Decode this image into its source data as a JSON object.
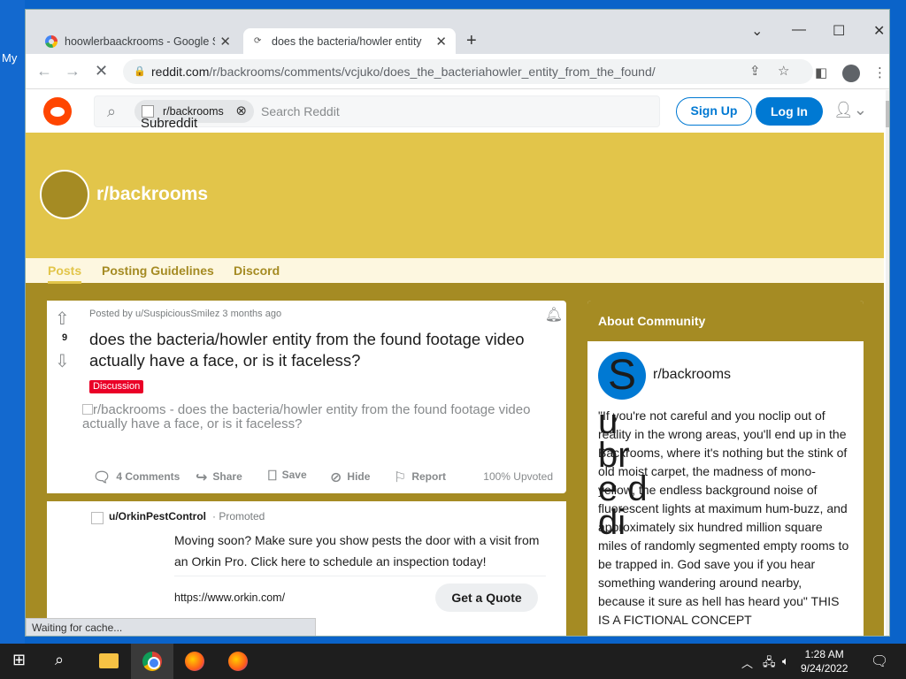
{
  "desktop": {
    "label": "My"
  },
  "browser": {
    "tabs": [
      {
        "title": "hoowlerbaackrooms - Google Se",
        "close": "✕"
      },
      {
        "title": "does the bacteria/howler entity fr",
        "close": "✕"
      }
    ],
    "new_tab": "+",
    "window_controls": {
      "minimize": "—",
      "maximize": "☐",
      "close": "✕",
      "dropdown": "⌄"
    },
    "url_host": "reddit.com",
    "url_path": "/r/backrooms/comments/vcjuko/does_the_bacteriahowler_entity_from_the_found/",
    "status": "Waiting for cache..."
  },
  "reddit": {
    "search": {
      "chip_label": "r/backrooms",
      "chip_alt": "Subreddit Icon",
      "placeholder": "Search Reddit"
    },
    "signup": "Sign Up",
    "login": "Log In",
    "subreddit": "r/backrooms",
    "nav": [
      "Posts",
      "Posting Guidelines",
      "Discord"
    ],
    "post": {
      "meta": "Posted by u/SuspiciousSmilez 3 months ago",
      "votes": "9",
      "title": "does the bacteria/howler entity from the found footage video actually have a face, or is it faceless?",
      "flair": "Discussion",
      "image_alt": "r/backrooms - does the bacteria/howler entity from the found footage video actually have a face, or is it faceless?",
      "actions": {
        "comments": "4 Comments",
        "share": "Share",
        "save": "Save",
        "hide": "Hide",
        "report": "Report"
      },
      "upvoted": "100% Upvoted"
    },
    "promo": {
      "user": "u/OrkinPestControl",
      "tag": "· Promoted",
      "text": "Moving soon? Make sure you show pests the door with a visit from an Orkin Pro. Click here to schedule an inspection today!",
      "url": "https://www.orkin.com/",
      "cta": "Get a Quote"
    },
    "about": {
      "header": "About Community",
      "avatar_letter": "S",
      "name": "r/backrooms",
      "alt_overlay": "u br e d di",
      "description": "\"If you're not careful and you noclip out of reality in the wrong areas, you'll end up in the Backrooms, where it's nothing but the stink of old moist carpet, the madness of mono-yellow, the endless background noise of fluorescent lights at maximum hum-buzz, and approximately six hundred million square miles of randomly segmented empty rooms to be trapped in. God save you if you hear something wandering around nearby, because it sure as hell has heard you\" THIS IS A FICTIONAL CONCEPT"
    }
  },
  "taskbar": {
    "time": "1:28 AM",
    "date": "9/24/2022",
    "notifications": "1"
  },
  "colors": {
    "brand": "#ff4500",
    "accent": "#0079d3",
    "banner": "#e2c54a",
    "body": "#a58b23"
  }
}
